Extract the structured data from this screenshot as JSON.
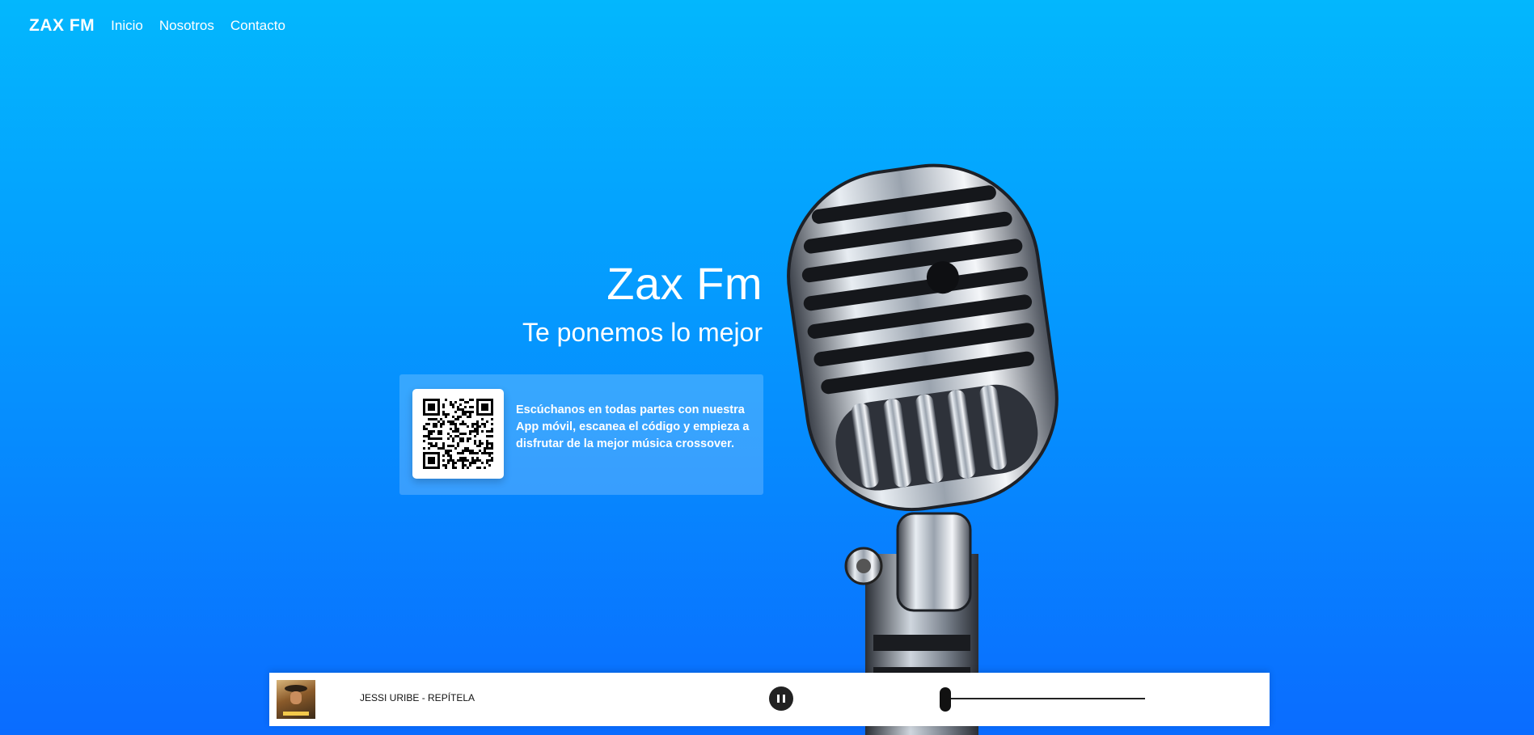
{
  "nav": {
    "brand": "ZAX FM",
    "links": [
      "Inicio",
      "Nosotros",
      "Contacto"
    ]
  },
  "hero": {
    "title": "Zax Fm",
    "subtitle": "Te ponemos lo mejor"
  },
  "app_card": {
    "text": "Escúchanos en todas partes con nuestra App móvil, escanea el código y empieza a disfrutar de la mejor música crossover."
  },
  "player": {
    "track": "JESSI URIBE - REPÍTELA",
    "state_icon": "pause-icon",
    "volume": 0
  },
  "colors": {
    "bg_top": "#03b7fd",
    "bg_bottom": "#0a6cff",
    "player_bg": "#ffffff"
  }
}
